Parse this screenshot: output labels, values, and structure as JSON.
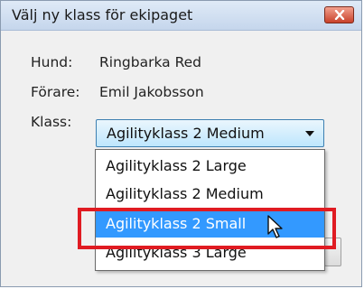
{
  "window": {
    "title": "Välj ny klass för ekipaget"
  },
  "fields": {
    "hund_label": "Hund:",
    "hund_value": "Ringbarka Red",
    "forare_label": "Förare:",
    "forare_value": "Emil Jakobsson",
    "klass_label": "Klass:"
  },
  "combo": {
    "selected": "Agilityklass 2 Medium"
  },
  "dropdown": {
    "options": [
      "Agilityklass 2 Large",
      "Agilityklass 2 Medium",
      "Agilityklass 2 Small",
      "Agilityklass 3 Large"
    ],
    "highlighted": "Agilityklass 2 Small"
  },
  "colors": {
    "highlight": "#3399ff",
    "annotation": "#e01b22",
    "close_button": "#c8412a"
  },
  "icons": [
    "close-icon",
    "chevron-down-icon",
    "mouse-pointer-icon"
  ]
}
